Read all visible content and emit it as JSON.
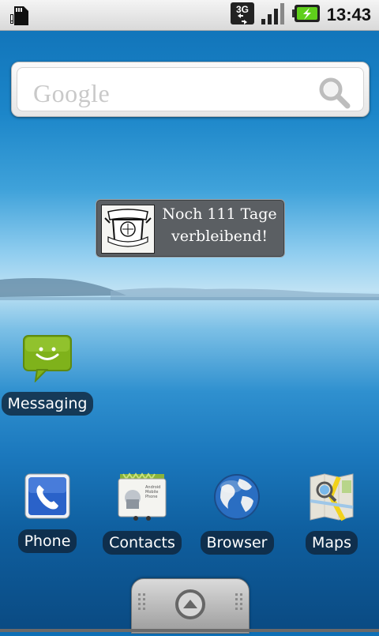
{
  "status_bar": {
    "time": "13:43",
    "network_type": "3G",
    "icons": [
      "sd-card-icon",
      "3g-data-icon",
      "signal-strength-icon",
      "battery-charging-icon"
    ]
  },
  "search_widget": {
    "logo_text": "Google",
    "icon": "magnifier-icon"
  },
  "countdown_widget": {
    "text_line1": "Noch 111 Tage",
    "text_line2": "verbleibend!"
  },
  "apps": {
    "messaging": {
      "label": "Messaging",
      "icon": "messaging-icon"
    },
    "phone": {
      "label": "Phone",
      "icon": "phone-icon"
    },
    "contacts": {
      "label": "Contacts",
      "icon": "contacts-icon",
      "card_text": "Android Mobile Phone"
    },
    "browser": {
      "label": "Browser",
      "icon": "globe-icon"
    },
    "maps": {
      "label": "Maps",
      "icon": "maps-icon"
    }
  },
  "app_drawer": {
    "icon": "arrow-up-icon"
  },
  "colors": {
    "status_bar_bg": "#e8e8e8",
    "label_bg": "#0f2337",
    "messaging_green": "#7fb21b",
    "phone_blue": "#2a62c9"
  }
}
